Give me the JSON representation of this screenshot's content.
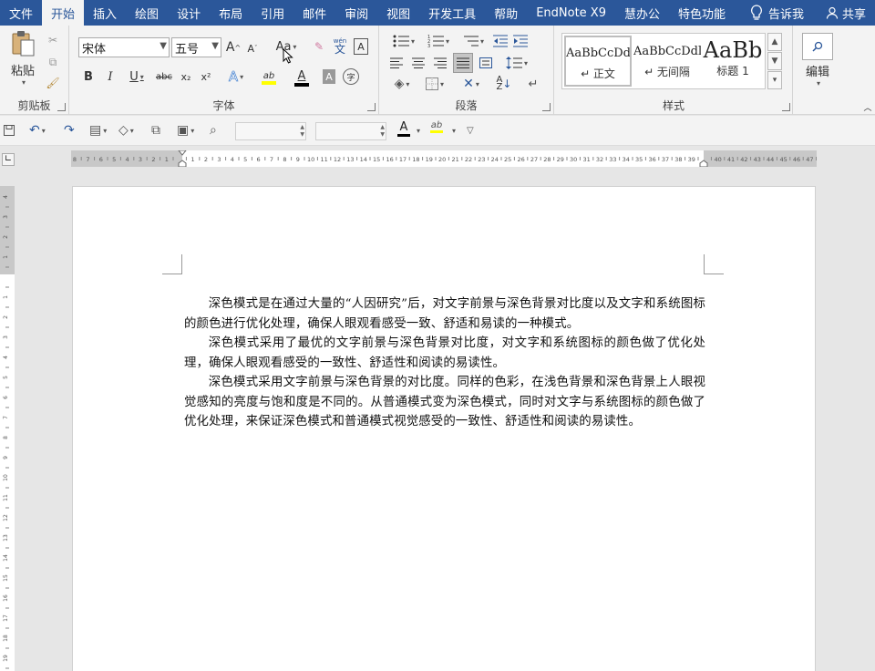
{
  "ribbon_tabs": [
    "文件",
    "开始",
    "插入",
    "绘图",
    "设计",
    "布局",
    "引用",
    "邮件",
    "审阅",
    "视图",
    "开发工具",
    "帮助",
    "EndNote X9",
    "慧办公",
    "特色功能"
  ],
  "active_tab": "开始",
  "tell_me": "告诉我",
  "share": "共享",
  "clipboard": {
    "paste_label": "粘贴",
    "group_label": "剪贴板"
  },
  "font": {
    "name": "宋体",
    "size": "五号",
    "group_label": "字体",
    "grow": "A",
    "shrink": "A",
    "change_case": "Aa",
    "wen_top": "wén",
    "wen": "文",
    "box": "A",
    "bold": "B",
    "italic": "I",
    "underline": "U",
    "strike": "abc",
    "subscript": "x₂",
    "superscript": "x²",
    "effects": "A",
    "highlight": "ab",
    "color": "A",
    "char_shading": "A",
    "encircle": "字"
  },
  "paragraph": {
    "group_label": "段落"
  },
  "styles": {
    "group_label": "样式",
    "items": [
      {
        "sample": "AaBbCcDdl",
        "name": "↵ 正文"
      },
      {
        "sample": "AaBbCcDdl",
        "name": "↵ 无间隔"
      },
      {
        "sample": "AaBb",
        "name": "标题 1"
      }
    ]
  },
  "editing": {
    "label": "编辑"
  },
  "document": {
    "paragraphs": [
      "深色模式是在通过大量的“人因研究”后，对文字前景与深色背景对比度以及文字和系统图标的颜色进行优化处理，确保人眼观看感受一致、舒适和易读的一种模式。",
      "深色模式采用了最优的文字前景与深色背景对比度，对文字和系统图标的颜色做了优化处理，确保人眼观看感受的一致性、舒适性和阅读的易读性。",
      "深色模式采用文字前景与深色背景的对比度。同样的色彩，在浅色背景和深色背景上人眼视觉感知的亮度与饱和度是不同的。从普通模式变为深色模式，同时对文字与系统图标的颜色做了优化处理，来保证深色模式和普通模式视觉感受的一致性、舒适性和阅读的易读性。"
    ]
  },
  "ruler_marks": [
    "8",
    "7",
    "6",
    "5",
    "4",
    "3",
    "2",
    "1",
    "",
    "1",
    "2",
    "3",
    "4",
    "5",
    "6",
    "7",
    "8",
    "9",
    "10",
    "11",
    "12",
    "13",
    "14",
    "15",
    "16",
    "17",
    "18",
    "19",
    "20",
    "21",
    "22",
    "23",
    "24",
    "25",
    "26",
    "27",
    "28",
    "29",
    "30",
    "31",
    "32",
    "33",
    "34",
    "35",
    "36",
    "37",
    "38",
    "39",
    "",
    "40",
    "41",
    "42",
    "43",
    "44",
    "45",
    "46",
    "47",
    "48"
  ],
  "vruler_marks": [
    "4",
    "3",
    "2",
    "1",
    "",
    "1",
    "2",
    "3",
    "4",
    "5",
    "6",
    "7",
    "8",
    "9",
    "10",
    "11",
    "12",
    "13",
    "14",
    "15",
    "16",
    "17",
    "18",
    "19",
    "20"
  ],
  "colors": {
    "brand": "#2b579a",
    "ribbon_bg": "#f3f3f3",
    "font_color_bar": "#000000",
    "highlight_bar": "#ffff00"
  }
}
